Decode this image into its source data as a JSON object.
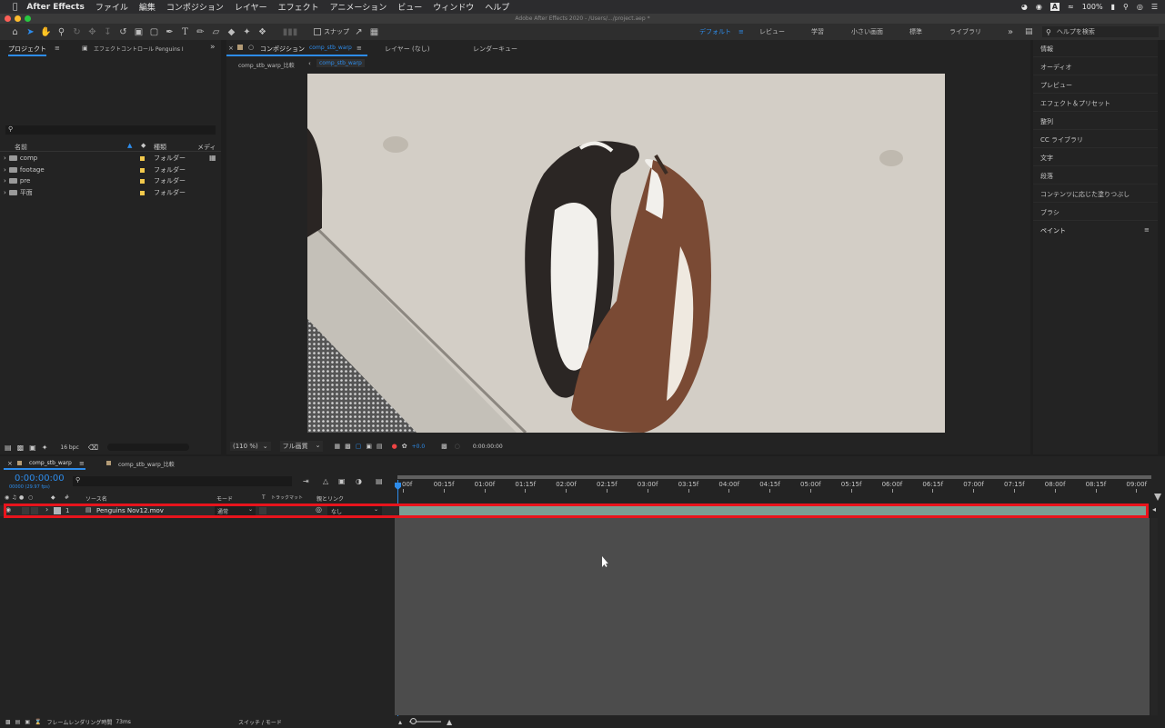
{
  "menubar": {
    "app": "After Effects",
    "items": [
      "ファイル",
      "編集",
      "コンポジション",
      "レイヤー",
      "エフェクト",
      "アニメーション",
      "ビュー",
      "ウィンドウ",
      "ヘルプ"
    ],
    "battery": "100%"
  },
  "titlebar": {
    "title": "Adobe After Effects 2020 - /Users/.../project.aep *"
  },
  "toolbar": {
    "snap_label": "スナップ",
    "workspaces": [
      "デフォルト",
      "レビュー",
      "学習",
      "小さい画面",
      "標準",
      "ライブラリ"
    ],
    "help_placeholder": "ヘルプを検索"
  },
  "project_panel": {
    "tabs": [
      "プロジェクト",
      "エフェクトコントロール Penguins I"
    ],
    "columns": {
      "name": "名前",
      "type": "種類",
      "media": "メディ"
    },
    "items": [
      {
        "name": "comp",
        "type": "フォルダー"
      },
      {
        "name": "footage",
        "type": "フォルダー"
      },
      {
        "name": "pre",
        "type": "フォルダー"
      },
      {
        "name": "平面",
        "type": "フォルダー"
      }
    ],
    "bpc": "16 bpc"
  },
  "comp_panel": {
    "tab_prefix": "コンポジション",
    "tab_comp": "comp_stb_warp",
    "layer_tab": "レイヤー (なし)",
    "render_tab": "レンダーキュー",
    "breadcrumbs": [
      "comp_stb_warp_比較",
      "comp_stb_warp"
    ],
    "zoom": "(110 %)",
    "quality": "フル画質",
    "exposure": "+0.0",
    "timecode": "0:00:00:00"
  },
  "right_panel": {
    "items": [
      "情報",
      "オーディオ",
      "プレビュー",
      "エフェクト＆プリセット",
      "整列",
      "CC ライブラリ",
      "文字",
      "段落",
      "コンテンツに応じた塗りつぶし",
      "ブラシ",
      "ペイント"
    ]
  },
  "timeline": {
    "tabs": [
      "comp_stb_warp",
      "comp_stb_warp_比較"
    ],
    "timecode": "0:00:00:00",
    "frames": "00000 (29.97 fps)",
    "columns": {
      "source": "ソース名",
      "mode": "モード",
      "t": "T",
      "trkmat": "トラックマット",
      "parent": "親とリンク",
      "num": "#"
    },
    "ruler": [
      "00f",
      "00:15f",
      "01:00f",
      "01:15f",
      "02:00f",
      "02:15f",
      "03:00f",
      "03:15f",
      "04:00f",
      "04:15f",
      "05:00f",
      "05:15f",
      "06:00f",
      "06:15f",
      "07:00f",
      "07:15f",
      "08:00f",
      "08:15f",
      "09:00f"
    ],
    "layer": {
      "index": "1",
      "name": "Penguins Nov12.mov",
      "mode": "通常",
      "parent": "なし"
    },
    "footer": {
      "render_label": "フレームレンダリング時間",
      "render_time": "73ms",
      "switch_mode": "スイッチ / モード"
    }
  },
  "colors": {
    "accent": "#2d8ceb",
    "highlight": "#e8141c",
    "layer_bar": "#7a9e93"
  }
}
